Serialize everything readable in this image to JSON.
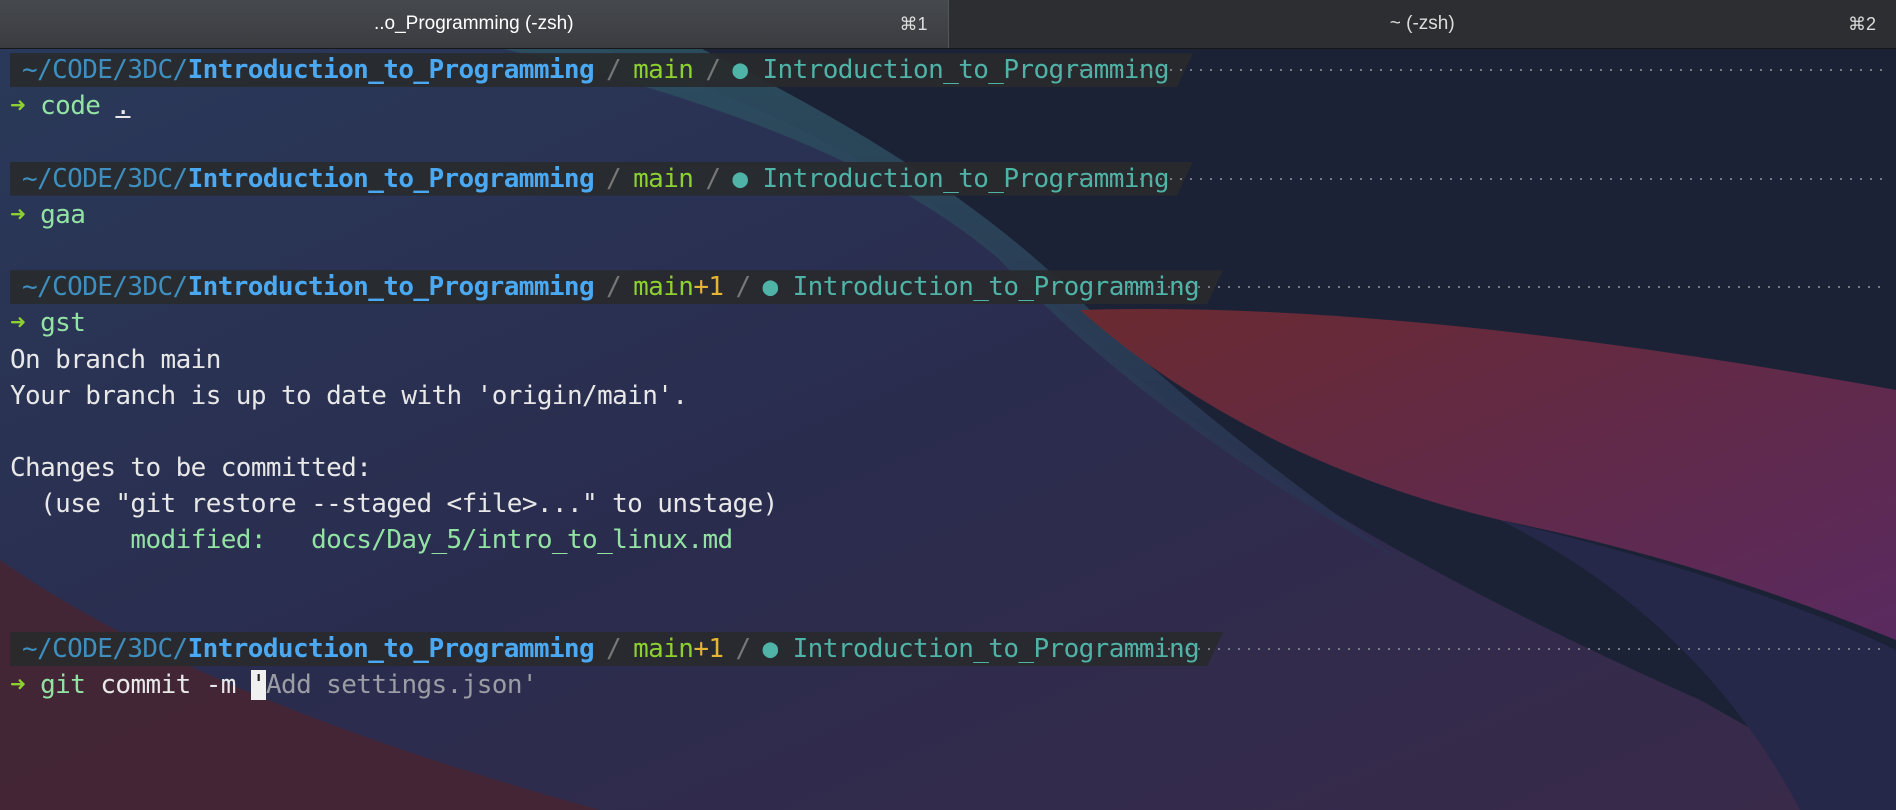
{
  "tabs": [
    {
      "title": "..o_Programming (-zsh)",
      "shortcut": "⌘1"
    },
    {
      "title": "~ (-zsh)",
      "shortcut": "⌘2"
    }
  ],
  "prompts": [
    {
      "path_dim": "~/CODE/3DC/",
      "path_bold": "Introduction_to_Programming",
      "branch": "main",
      "status": "",
      "venv": "Introduction_to_Programming",
      "command": "code",
      "arg": "."
    },
    {
      "path_dim": "~/CODE/3DC/",
      "path_bold": "Introduction_to_Programming",
      "branch": "main",
      "status": "",
      "venv": "Introduction_to_Programming",
      "command": "gaa",
      "arg": ""
    },
    {
      "path_dim": "~/CODE/3DC/",
      "path_bold": "Introduction_to_Programming",
      "branch": "main",
      "status": "+1",
      "venv": "Introduction_to_Programming",
      "command": "gst",
      "arg": ""
    },
    {
      "path_dim": "~/CODE/3DC/",
      "path_bold": "Introduction_to_Programming",
      "branch": "main",
      "status": "+1",
      "venv": "Introduction_to_Programming",
      "command": "git",
      "arg": "commit -m ",
      "cursor_char": "'",
      "suggestion": "Add settings.json'"
    }
  ],
  "arrow": "➜",
  "output": {
    "l1": "On branch main",
    "l2": "Your branch is up to date with 'origin/main'.",
    "l3": "Changes to be committed:",
    "l4": "  (use \"git restore --staged <file>...\" to unstage)",
    "mod_label": "        modified:   ",
    "mod_file": "docs/Day_5/intro_to_linux.md"
  },
  "colors": {
    "branch": "#8dd12f",
    "status": "#e5b335",
    "path": "#4aa9f2",
    "venv": "#4fb3a7"
  }
}
